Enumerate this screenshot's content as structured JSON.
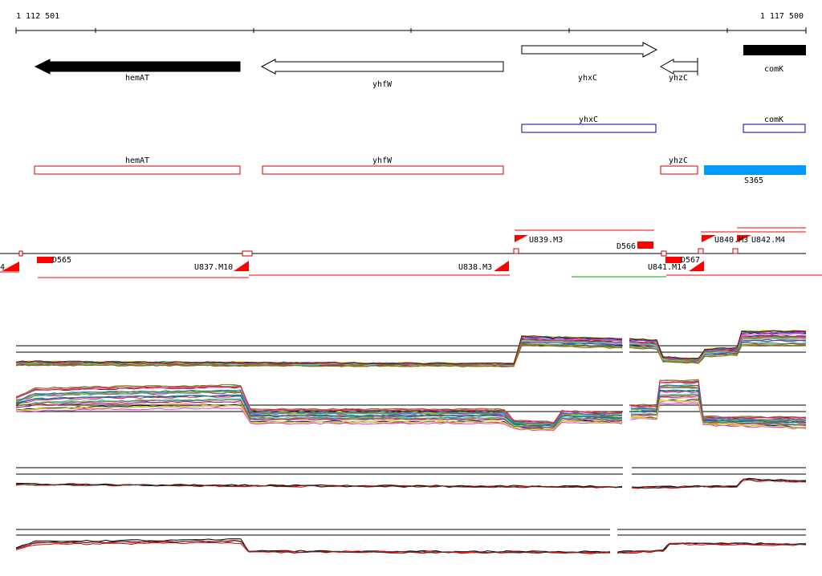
{
  "ruler": {
    "start": "1 112 501",
    "end": "1 117 500"
  },
  "genes": [
    {
      "id": "hemAT",
      "label": "hemAT",
      "strand": "-",
      "style": "filled"
    },
    {
      "id": "yhfW",
      "label": "yhfW",
      "strand": "-",
      "style": "outline"
    },
    {
      "id": "yhxC",
      "label": "yhxC",
      "strand": "+",
      "style": "outline"
    },
    {
      "id": "yhzC",
      "label": "yhzC",
      "strand": "-",
      "style": "outline"
    },
    {
      "id": "comK",
      "label": "comK",
      "strand": "+",
      "style": "filled"
    }
  ],
  "blue_track": [
    {
      "id": "yhxC",
      "label": "yhxC"
    },
    {
      "id": "comK",
      "label": "comK"
    }
  ],
  "red_track": [
    {
      "id": "hemAT",
      "label": "hemAT"
    },
    {
      "id": "yhfW",
      "label": "yhfW"
    },
    {
      "id": "yhzC",
      "label": "yhzC"
    }
  ],
  "feature_S365": {
    "label": "S365",
    "color": "#0099ff"
  },
  "transcripts": {
    "clipped_left": "4",
    "D565": "D565",
    "U837": "U837.M10",
    "U838": "U838.M3",
    "U839": "U839.M3",
    "D566": "D566",
    "U840": "U840.M3",
    "U842": "U842.M4",
    "U841": "U841.M14",
    "D567": "D567"
  },
  "colors": {
    "gene_filled": "#000000",
    "blue_outline": "#0000aa",
    "red_outline": "#cc0000",
    "marker_red": "#ff0000",
    "expr_green": "#00aa00"
  }
}
